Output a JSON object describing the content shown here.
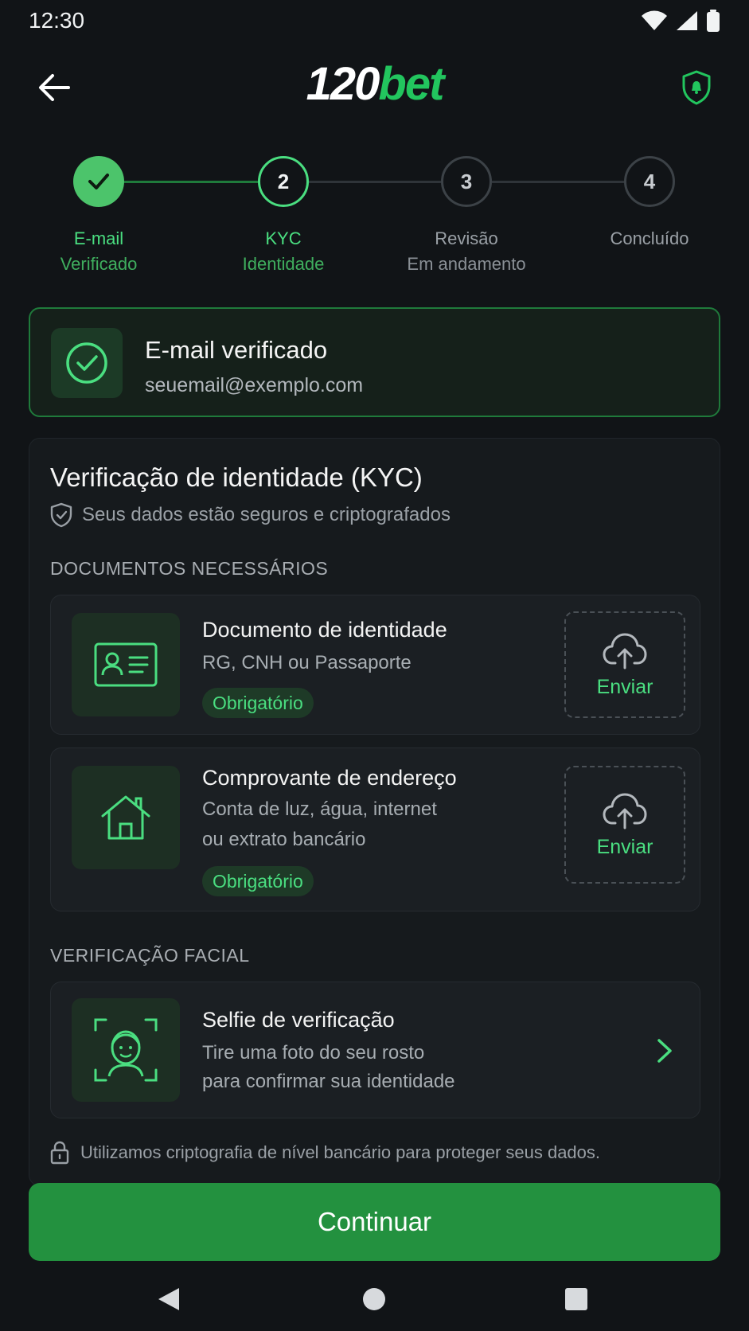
{
  "status_bar": {
    "time": "12:30"
  },
  "header": {
    "logo_part1": "120",
    "logo_part2": "bet"
  },
  "stepper": {
    "steps": [
      {
        "number": "",
        "title": "E-mail",
        "subtitle": "Verificado"
      },
      {
        "number": "2",
        "title": "KYC",
        "subtitle": "Identidade"
      },
      {
        "number": "3",
        "title": "Revisão",
        "subtitle": "Em andamento"
      },
      {
        "number": "4",
        "title": "Concluído",
        "subtitle": ""
      }
    ]
  },
  "email_card": {
    "title": "E-mail verificado",
    "email": "seuemail@exemplo.com"
  },
  "kyc": {
    "title": "Verificação de identidade (KYC)",
    "subtitle": "Seus dados estão seguros e criptografados",
    "documents_label": "DOCUMENTOS NECESSÁRIOS",
    "documents": [
      {
        "title": "Documento de identidade",
        "desc_line1": "RG, CNH ou Passaporte",
        "desc_line2": "",
        "badge": "Obrigatório",
        "upload_label": "Enviar"
      },
      {
        "title": "Comprovante de endereço",
        "desc_line1": "Conta de luz, água, internet",
        "desc_line2": "ou extrato bancário",
        "badge": "Obrigatório",
        "upload_label": "Enviar"
      }
    ],
    "facial_label": "VERIFICAÇÃO FACIAL",
    "selfie": {
      "title": "Selfie de verificação",
      "desc_line1": "Tire uma foto do seu rosto",
      "desc_line2": "para confirmar sua identidade"
    },
    "security_note": "Utilizamos criptografia de nível bancário para proteger seus dados."
  },
  "continue_label": "Continuar",
  "colors": {
    "accent": "#22c55e",
    "accent_soft": "#4ade80",
    "button": "#23913f",
    "background": "#111417"
  }
}
